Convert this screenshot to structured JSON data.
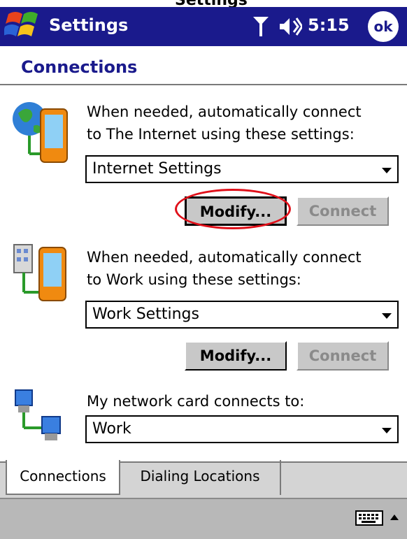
{
  "window": {
    "clip_caption": "Settings",
    "title": "Settings",
    "clock": "5:15",
    "ok_label": "ok"
  },
  "page": {
    "title": "Connections"
  },
  "internet": {
    "description_line1": "When needed, automatically connect",
    "description_line2": "to The Internet using these settings:",
    "selected": "Internet Settings",
    "modify_label": "Modify...",
    "connect_label": "Connect"
  },
  "work": {
    "description_line1": "When needed, automatically connect",
    "description_line2": "to Work using these settings:",
    "selected": "Work Settings",
    "modify_label": "Modify...",
    "connect_label": "Connect"
  },
  "network_card": {
    "description": "My network card connects to:",
    "selected": "Work"
  },
  "tabs": [
    {
      "label": "Connections",
      "active": true
    },
    {
      "label": "Dialing Locations",
      "active": false
    }
  ],
  "colors": {
    "titlebar": "#1a1a8c",
    "highlight_ring": "#e0101a",
    "button_face": "#c8c8c8"
  },
  "icons": [
    "windows-start-icon",
    "signal-icon",
    "volume-icon",
    "internet-device-icon",
    "work-device-icon",
    "network-card-icon",
    "keyboard-icon",
    "sip-arrow-icon"
  ]
}
